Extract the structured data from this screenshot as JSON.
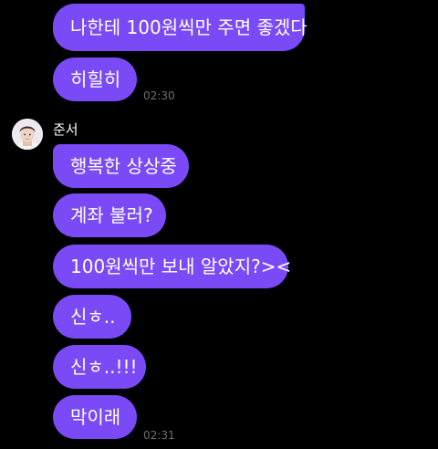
{
  "accent_color": "#7a4af7",
  "previous_group": {
    "messages": [
      {
        "text": "나한테 100원씩만 주면 좋겠다"
      },
      {
        "text": "히힐히"
      }
    ],
    "timestamp": "02:30"
  },
  "sender": {
    "name": "준서",
    "avatar_icon": "profile-photo-avatar"
  },
  "current_group": {
    "messages": [
      {
        "text": "행복한 상상중"
      },
      {
        "text": "계좌 불러?"
      },
      {
        "text": "100원씩만 보내 알았지?><"
      },
      {
        "text": "신ㅎ.."
      },
      {
        "text": "신ㅎ..!!!"
      },
      {
        "text": "막이래"
      }
    ],
    "timestamp": "02:31"
  }
}
